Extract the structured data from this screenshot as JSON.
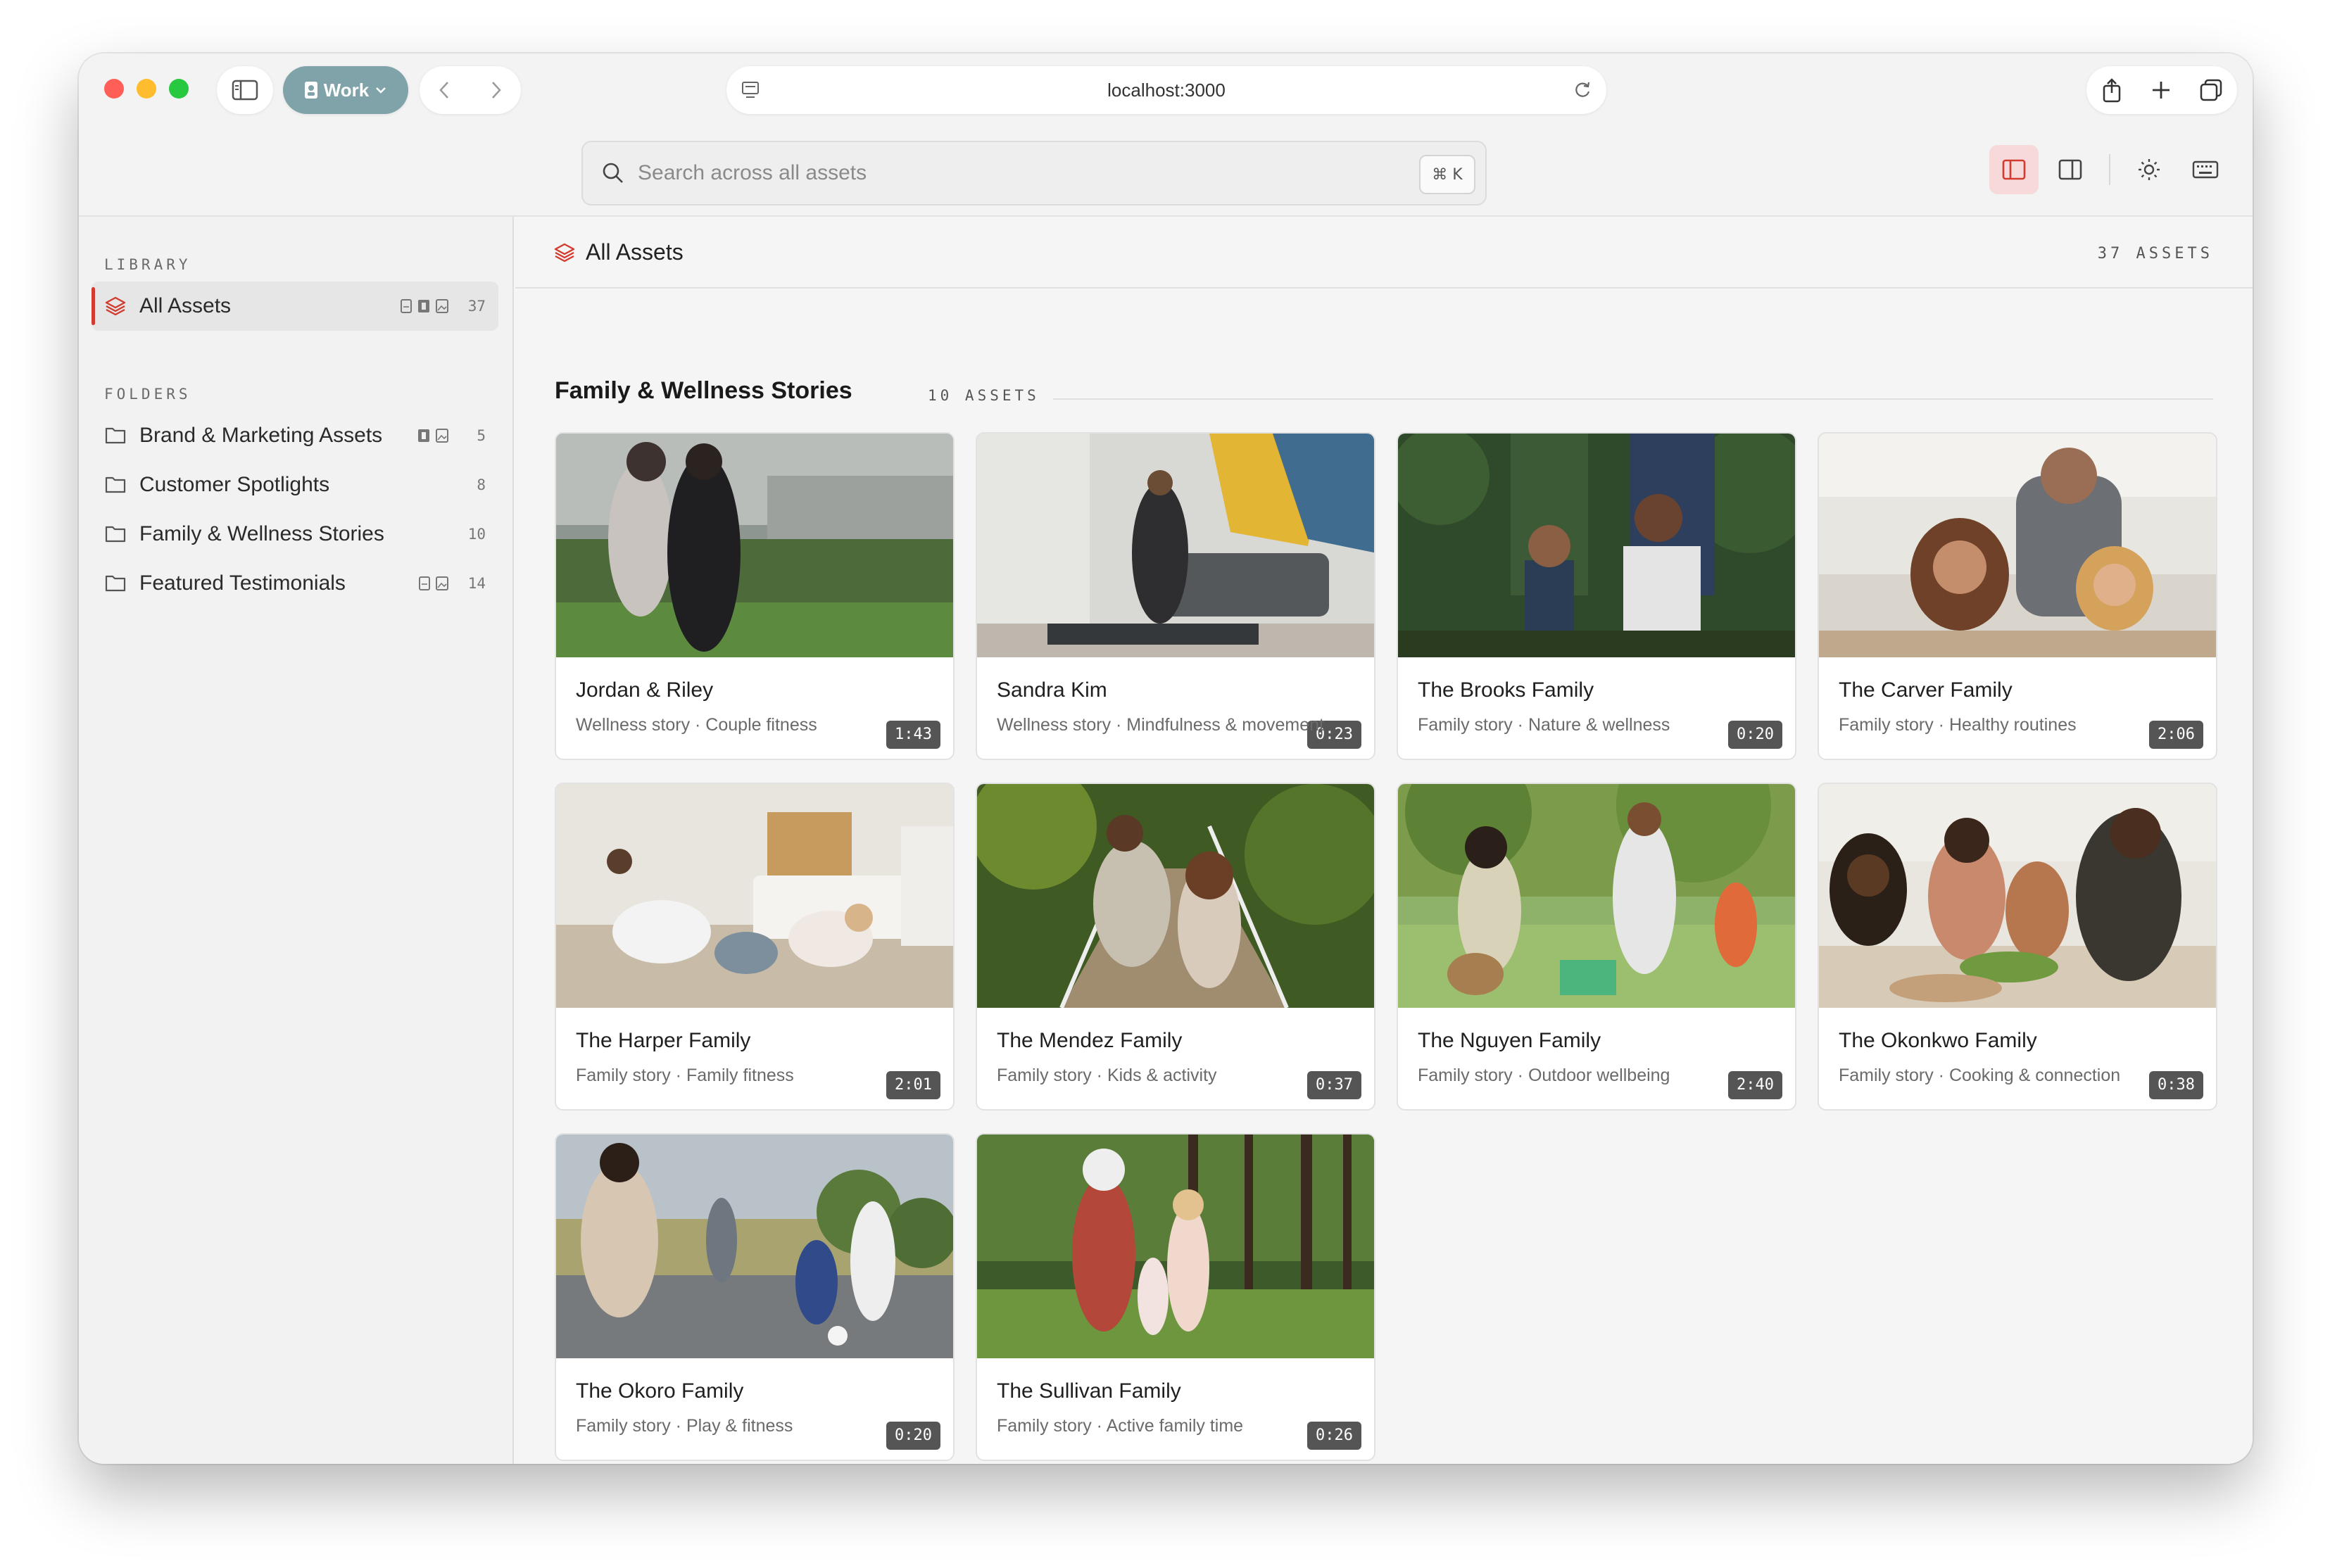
{
  "browser": {
    "profile_label": "Work",
    "url": "localhost:3000"
  },
  "search": {
    "placeholder": "Search across all assets",
    "shortcut": "⌘ K"
  },
  "sidebar": {
    "library_heading": "LIBRARY",
    "folders_heading": "FOLDERS",
    "library_items": [
      {
        "label": "All Assets",
        "count": "37",
        "active": true
      }
    ],
    "folders": [
      {
        "label": "Brand & Marketing Assets",
        "count": "5"
      },
      {
        "label": "Customer Spotlights",
        "count": "8"
      },
      {
        "label": "Family & Wellness Stories",
        "count": "10"
      },
      {
        "label": "Featured Testimonials",
        "count": "14"
      }
    ]
  },
  "main": {
    "title": "All Assets",
    "count_label": "37 ASSETS",
    "section": {
      "title": "Family & Wellness Stories",
      "count_label": "10 ASSETS"
    },
    "cards": [
      {
        "title": "Jordan & Riley",
        "subtitle": "Wellness story · Couple fitness",
        "duration": "1:43"
      },
      {
        "title": "Sandra Kim",
        "subtitle": "Wellness story · Mindfulness & movement",
        "duration": "0:23"
      },
      {
        "title": "The Brooks Family",
        "subtitle": "Family story · Nature & wellness",
        "duration": "0:20"
      },
      {
        "title": "The Carver Family",
        "subtitle": "Family story · Healthy routines",
        "duration": "2:06"
      },
      {
        "title": "The Harper Family",
        "subtitle": "Family story · Family fitness",
        "duration": "2:01"
      },
      {
        "title": "The Mendez Family",
        "subtitle": "Family story · Kids & activity",
        "duration": "0:37"
      },
      {
        "title": "The Nguyen Family",
        "subtitle": "Family story · Outdoor wellbeing",
        "duration": "2:40"
      },
      {
        "title": "The Okonkwo Family",
        "subtitle": "Family story · Cooking & connection",
        "duration": "0:38"
      },
      {
        "title": "The Okoro Family",
        "subtitle": "Family story · Play & fitness",
        "duration": "0:20"
      },
      {
        "title": "The Sullivan Family",
        "subtitle": "Family story · Active family time",
        "duration": "0:26"
      }
    ]
  },
  "colors": {
    "accent": "#d23b2f",
    "active_toggle_bg": "#f6d9d8",
    "profile_pill": "#7fa3a8"
  }
}
